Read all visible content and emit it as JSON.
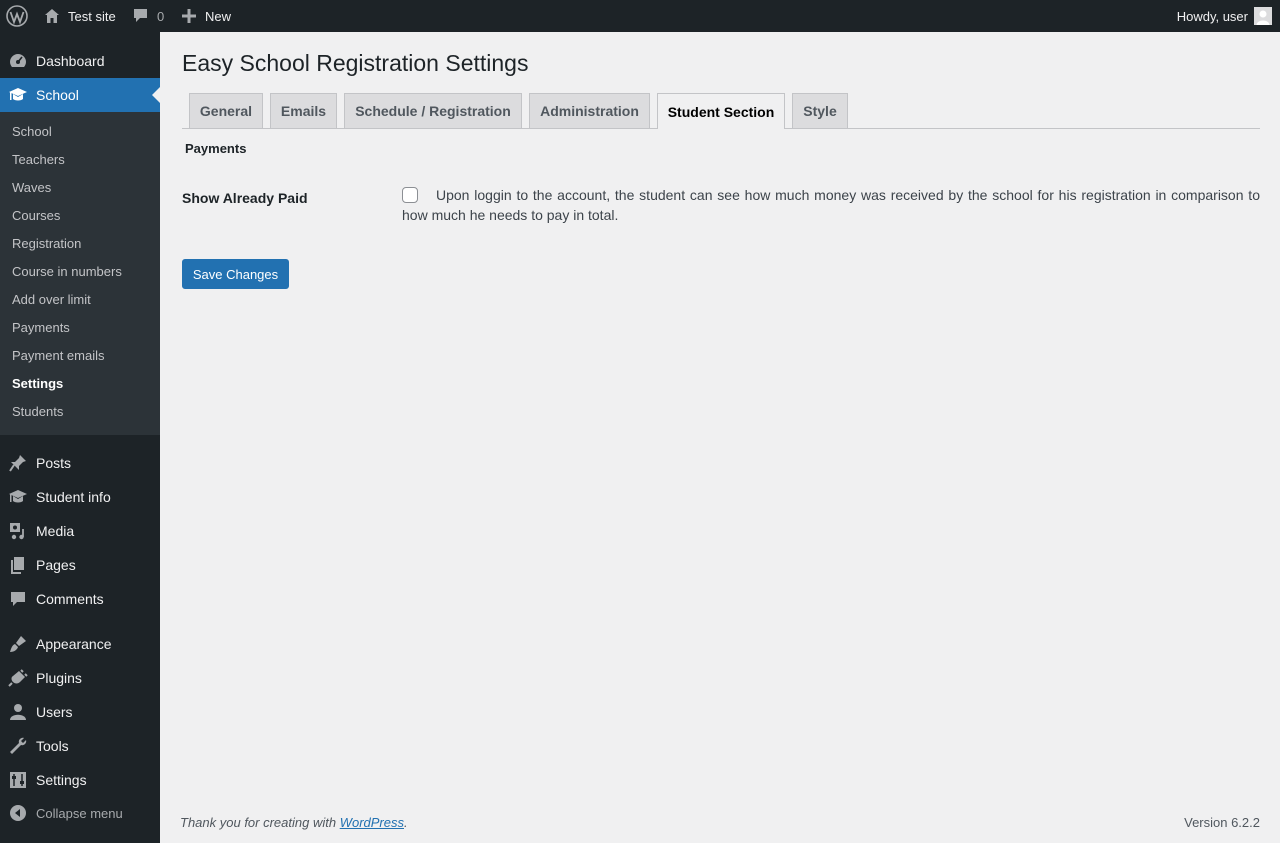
{
  "adminbar": {
    "site_name": "Test site",
    "comments_count": "0",
    "new_label": "New",
    "howdy": "Howdy, user"
  },
  "sidebar": {
    "top_items": [
      {
        "label": "Dashboard",
        "icon": "dashboard-icon"
      },
      {
        "label": "School",
        "icon": "school-icon"
      }
    ],
    "submenu": [
      "School",
      "Teachers",
      "Waves",
      "Courses",
      "Registration",
      "Course in numbers",
      "Add over limit",
      "Payments",
      "Payment emails",
      "Settings",
      "Students"
    ],
    "current_submenu": "Settings",
    "bottom_items": [
      {
        "label": "Posts",
        "icon": "pin-icon"
      },
      {
        "label": "Student info",
        "icon": "school-icon"
      },
      {
        "label": "Media",
        "icon": "media-icon"
      },
      {
        "label": "Pages",
        "icon": "pages-icon"
      },
      {
        "label": "Comments",
        "icon": "comment-icon"
      },
      {
        "label": "Appearance",
        "icon": "brush-icon"
      },
      {
        "label": "Plugins",
        "icon": "plugin-icon"
      },
      {
        "label": "Users",
        "icon": "user-icon"
      },
      {
        "label": "Tools",
        "icon": "wrench-icon"
      },
      {
        "label": "Settings",
        "icon": "settings-icon"
      }
    ],
    "collapse_label": "Collapse menu"
  },
  "main": {
    "title": "Easy School Registration Settings",
    "tabs": [
      {
        "label": "General"
      },
      {
        "label": "Emails"
      },
      {
        "label": "Schedule / Registration"
      },
      {
        "label": "Administration"
      },
      {
        "label": "Student Section"
      },
      {
        "label": "Style"
      }
    ],
    "active_tab": "Student Section",
    "section_title": "Payments",
    "field_label": "Show Already Paid",
    "field_checked": false,
    "field_description": "Upon loggin to the account, the student can see how much money was received by the school for his registration in comparison to how much he needs to pay in total.",
    "save_button": "Save Changes"
  },
  "footer": {
    "thanks_prefix": "Thank you for creating with ",
    "thanks_link": "WordPress",
    "thanks_suffix": ".",
    "version": "Version 6.2.2"
  },
  "colors": {
    "adminbar_bg": "#1d2327",
    "accent": "#2271b1",
    "submenu_bg": "#2c3338",
    "content_bg": "#f0f0f1"
  }
}
